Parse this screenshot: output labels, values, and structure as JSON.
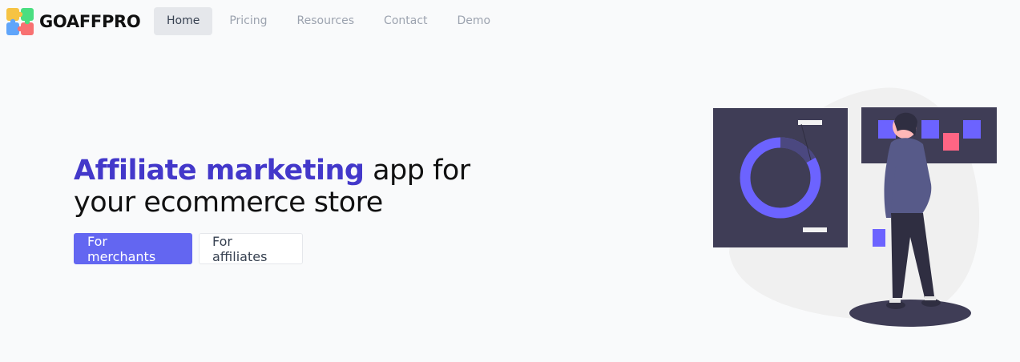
{
  "brand": {
    "name": "GOAFFPRO"
  },
  "nav": {
    "items": [
      {
        "label": "Home",
        "active": true
      },
      {
        "label": "Pricing"
      },
      {
        "label": "Resources"
      },
      {
        "label": "Contact"
      },
      {
        "label": "Demo"
      }
    ]
  },
  "hero": {
    "title_accent": "Affiliate marketing",
    "title_rest_1": " app for",
    "title_rest_2": "your ecommerce store",
    "cta_primary": "For merchants",
    "cta_secondary": "For affiliates"
  },
  "colors": {
    "accent": "#4338ca",
    "primary_button": "#6366f1",
    "illustration_panel": "#3f3d56",
    "illustration_highlight": "#6c63ff",
    "illustration_alert": "#ff6584"
  }
}
